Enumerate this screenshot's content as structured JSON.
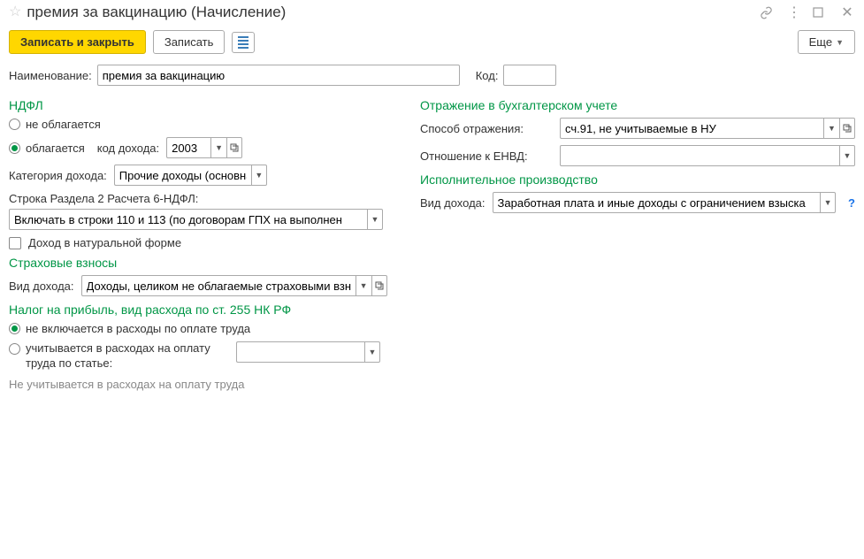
{
  "titlebar": {
    "title": "премия за вакцинацию (Начисление)"
  },
  "toolbar": {
    "save_close": "Записать и закрыть",
    "save": "Записать",
    "more": "Еще"
  },
  "name_row": {
    "label": "Наименование:",
    "value": "премия за вакцинацию",
    "code_label": "Код:",
    "code_value": ""
  },
  "left": {
    "ndfl": {
      "title": "НДФЛ",
      "not_taxed": "не облагается",
      "taxed": "облагается",
      "income_code_label": "код дохода:",
      "income_code_value": "2003",
      "category_label": "Категория дохода:",
      "category_value": "Прочие доходы (основна",
      "section2_label": "Строка Раздела 2 Расчета 6-НДФЛ:",
      "section2_value": "Включать в строки 110 и 113 (по договорам ГПХ на выполнен",
      "natural_label": "Доход в натуральной форме"
    },
    "insurance": {
      "title": "Страховые взносы",
      "income_type_label": "Вид дохода:",
      "income_type_value": "Доходы, целиком не облагаемые страховыми взн"
    },
    "profit": {
      "title": "Налог на прибыль, вид расхода по ст. 255 НК РФ",
      "not_included": "не включается в расходы по оплате труда",
      "included_label": "учитывается в расходах на оплату труда по статье:",
      "included_value": "",
      "note": "Не учитывается в расходах на оплату труда"
    }
  },
  "right": {
    "accounting": {
      "title": "Отражение в бухгалтерском учете",
      "method_label": "Способ отражения:",
      "method_value": "сч.91, не учитываемые в НУ",
      "envd_label": "Отношение к ЕНВД:",
      "envd_value": ""
    },
    "enforcement": {
      "title": "Исполнительное производство",
      "income_label": "Вид дохода:",
      "income_value": "Заработная плата и иные доходы с ограничением взыска"
    }
  }
}
